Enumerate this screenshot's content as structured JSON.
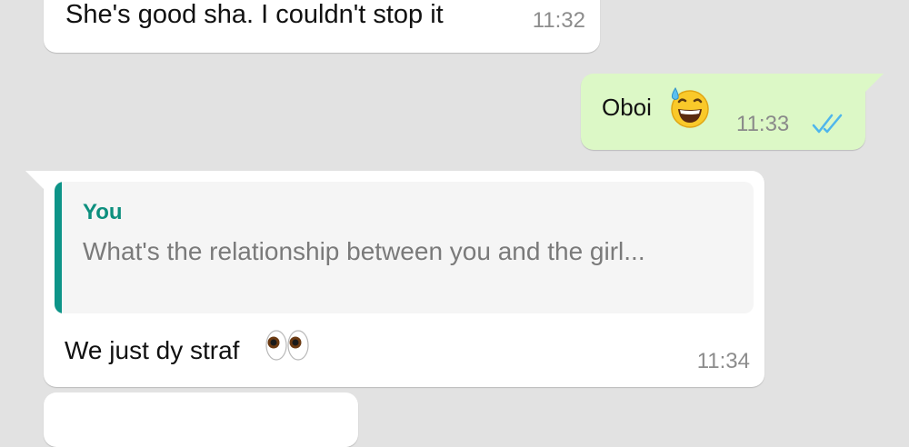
{
  "chat": {
    "messages": [
      {
        "direction": "incoming",
        "text": "She's good sha. I couldn't stop it",
        "time": "11:32"
      },
      {
        "direction": "outgoing",
        "text": "Oboi",
        "emoji": "grinning-sweat-emoji",
        "time": "11:33",
        "status": "read",
        "status_icon": "double-check-icon",
        "status_color": "#4fb6ec"
      },
      {
        "direction": "incoming",
        "reply": {
          "sender": "You",
          "text": "What's the relationship between you and the girl..."
        },
        "text": "We just dy straf",
        "emoji": "eyes-emoji",
        "time": "11:34"
      },
      {
        "direction": "incoming",
        "text": ""
      }
    ]
  },
  "colors": {
    "background": "#e2e2e2",
    "incoming_bubble": "#ffffff",
    "outgoing_bubble": "#dcf8c6",
    "reply_accent": "#0d9488",
    "timestamp": "#8c8c8c"
  }
}
